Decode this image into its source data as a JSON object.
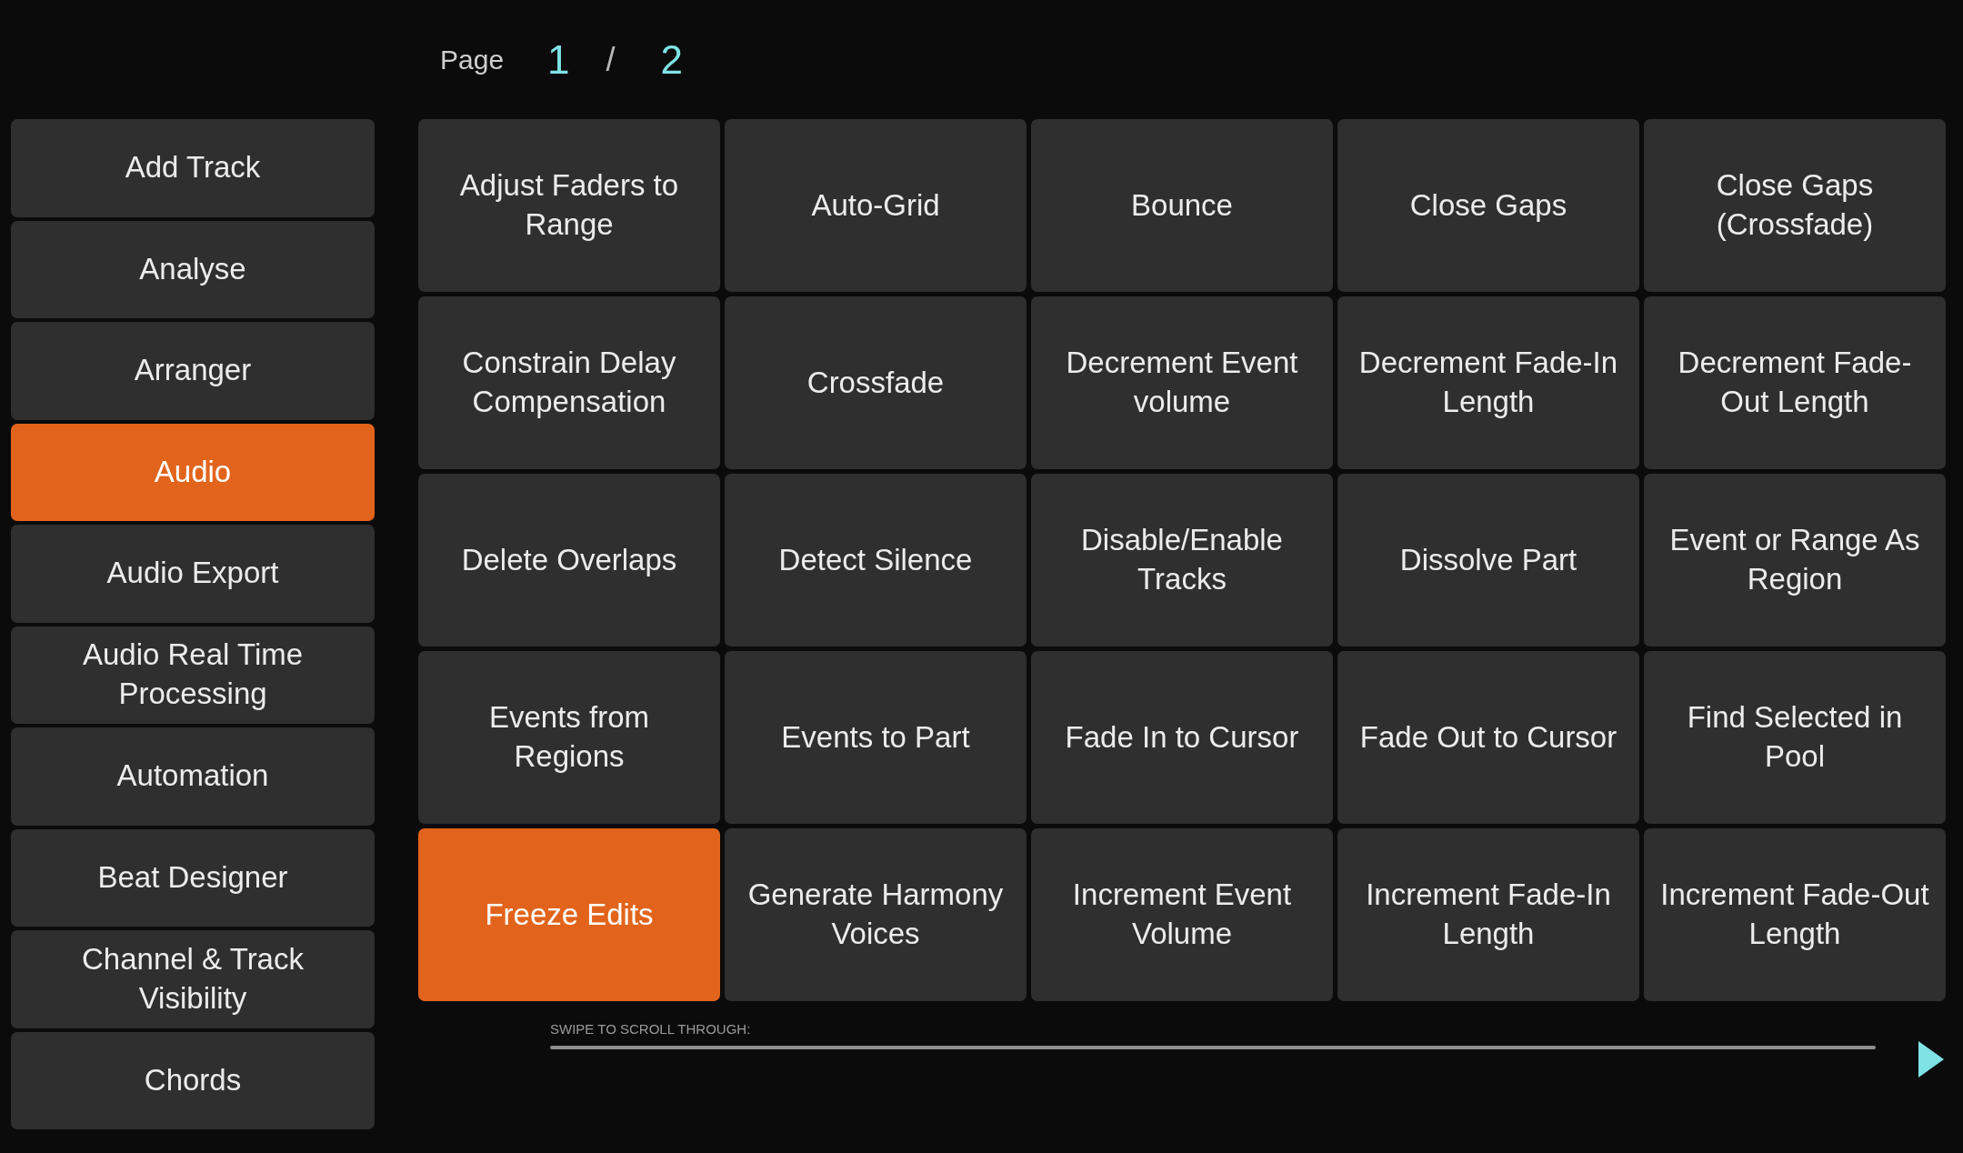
{
  "pager": {
    "label": "Page",
    "current": "1",
    "separator": "/",
    "total": "2"
  },
  "categories": [
    {
      "label": "Add Track",
      "selected": false
    },
    {
      "label": "Analyse",
      "selected": false
    },
    {
      "label": "Arranger",
      "selected": false
    },
    {
      "label": "Audio",
      "selected": true
    },
    {
      "label": "Audio Export",
      "selected": false
    },
    {
      "label": "Audio Real Time Processing",
      "selected": false
    },
    {
      "label": "Automation",
      "selected": false
    },
    {
      "label": "Beat Designer",
      "selected": false
    },
    {
      "label": "Channel & Track Visibility",
      "selected": false
    },
    {
      "label": "Chords",
      "selected": false
    }
  ],
  "commands": [
    {
      "label": "Adjust Faders to Range",
      "selected": false
    },
    {
      "label": "Auto-Grid",
      "selected": false
    },
    {
      "label": "Bounce",
      "selected": false
    },
    {
      "label": "Close Gaps",
      "selected": false
    },
    {
      "label": "Close Gaps (Crossfade)",
      "selected": false
    },
    {
      "label": "Constrain Delay Compensation",
      "selected": false
    },
    {
      "label": "Crossfade",
      "selected": false
    },
    {
      "label": "Decrement Event volume",
      "selected": false
    },
    {
      "label": "Decrement Fade-In Length",
      "selected": false
    },
    {
      "label": "Decrement Fade-Out Length",
      "selected": false
    },
    {
      "label": "Delete Overlaps",
      "selected": false
    },
    {
      "label": "Detect Silence",
      "selected": false
    },
    {
      "label": "Disable/Enable Tracks",
      "selected": false
    },
    {
      "label": "Dissolve Part",
      "selected": false
    },
    {
      "label": "Event or Range As Region",
      "selected": false
    },
    {
      "label": "Events from Regions",
      "selected": false
    },
    {
      "label": "Events to Part",
      "selected": false
    },
    {
      "label": "Fade In to Cursor",
      "selected": false
    },
    {
      "label": "Fade Out to Cursor",
      "selected": false
    },
    {
      "label": "Find Selected in Pool",
      "selected": false
    },
    {
      "label": "Freeze Edits",
      "selected": true
    },
    {
      "label": "Generate Harmony Voices",
      "selected": false
    },
    {
      "label": "Increment Event Volume",
      "selected": false
    },
    {
      "label": "Increment Fade-In Length",
      "selected": false
    },
    {
      "label": "Increment Fade-Out Length",
      "selected": false
    }
  ],
  "scroll_hint": "SWIPE TO SCROLL THROUGH:"
}
